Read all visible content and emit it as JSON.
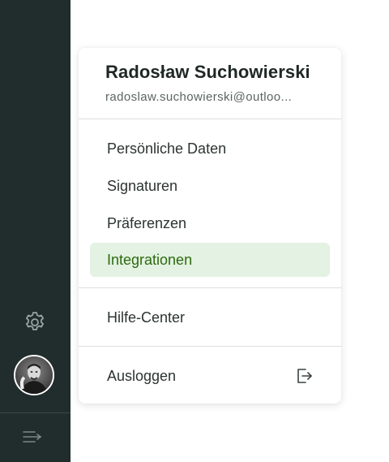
{
  "sidebar": {
    "settings_icon": "gear-icon",
    "avatar_icon": "user-avatar",
    "collapse_icon": "collapse-menu-icon"
  },
  "account_menu": {
    "user_name": "Radosław Suchowierski",
    "user_email": "radoslaw.suchowierski@outloo...",
    "items": [
      {
        "label": "Persönliche Daten"
      },
      {
        "label": "Signaturen"
      },
      {
        "label": "Präferenzen"
      },
      {
        "label": "Integrationen",
        "active": true
      }
    ],
    "help_label": "Hilfe-Center",
    "logout_label": "Ausloggen",
    "logout_icon": "logout-icon"
  },
  "colors": {
    "sidebar_bg": "#212d2c",
    "active_bg": "#e3f2e2",
    "active_text": "#2d6a0f"
  }
}
